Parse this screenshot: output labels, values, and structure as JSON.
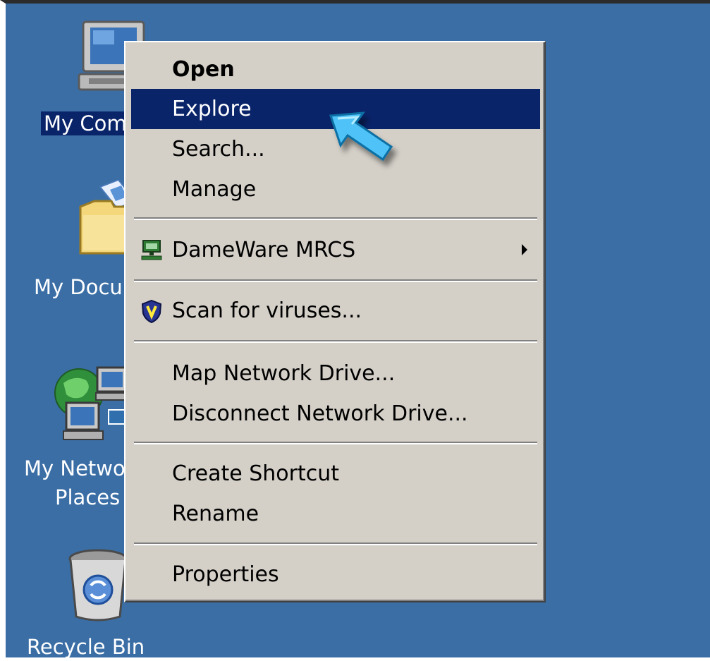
{
  "desktop": {
    "background_color": "#3a6ea5",
    "icons": [
      {
        "label": "My Computer",
        "visible_label": "My Com",
        "icon": "computer-icon"
      },
      {
        "label": "My Documents",
        "visible_label": "My Docu",
        "icon": "folder-icon"
      },
      {
        "label": "My Network Places",
        "visible_label_line1": "My Netwo",
        "visible_label_line2": "Places",
        "icon": "network-icon"
      },
      {
        "label": "Recycle Bin",
        "visible_label": "Recycle Bin",
        "icon": "recycle-bin-icon"
      }
    ]
  },
  "context_menu": {
    "items": [
      {
        "label": "Open",
        "default": true
      },
      {
        "label": "Explore",
        "highlighted": true
      },
      {
        "label": "Search..."
      },
      {
        "label": "Manage"
      },
      {
        "label": "DameWare MRCS",
        "icon": "dameware-icon",
        "submenu": true
      },
      {
        "label": "Scan for viruses...",
        "icon": "antivirus-shield-icon"
      },
      {
        "label": "Map Network Drive..."
      },
      {
        "label": "Disconnect Network Drive..."
      },
      {
        "label": "Create Shortcut"
      },
      {
        "label": "Rename"
      },
      {
        "label": "Properties"
      }
    ],
    "highlight_color": "#0a246a",
    "menu_color": "#d4d0c8"
  },
  "cursor": {
    "icon": "pointer-arrow-icon",
    "color": "#4fc3f7"
  }
}
